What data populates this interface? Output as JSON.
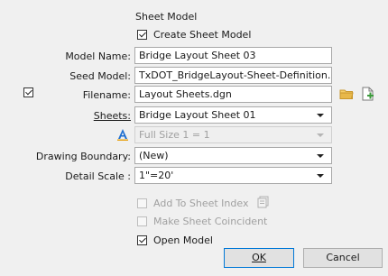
{
  "sheet_model": {
    "title": "Sheet Model",
    "create_sheet_model": {
      "label": "Create Sheet Model",
      "checked": true
    }
  },
  "fields": {
    "model_name": {
      "label": "Model Name:",
      "value": "Bridge Layout Sheet 03"
    },
    "seed_model": {
      "label": "Seed Model:",
      "value": "TxDOT_BridgeLayout-Sheet-Definition.dg"
    },
    "filename": {
      "label": "Filename:",
      "value": "Layout Sheets.dgn",
      "checked": true
    },
    "sheets": {
      "label": "Sheets:",
      "value": "Bridge Layout Sheet 01"
    },
    "annotation_scale": {
      "value": "Full Size 1 = 1"
    },
    "drawing_boundary": {
      "label": "Drawing Boundary:",
      "value": "(New)"
    },
    "detail_scale": {
      "label": "Detail Scale :",
      "value": "1\"=20'"
    }
  },
  "options": {
    "add_to_sheet_index": {
      "label": "Add To Sheet Index",
      "checked": false,
      "enabled": false
    },
    "make_sheet_coincident": {
      "label": "Make Sheet Coincident",
      "checked": false,
      "enabled": false
    },
    "open_model": {
      "label": "Open Model",
      "checked": true,
      "enabled": true
    }
  },
  "buttons": {
    "ok": "OK",
    "cancel": "Cancel"
  },
  "icons": {
    "browse": "folder-open-icon",
    "new_file": "new-file-icon",
    "annotation_scale": "annotation-scale-icon",
    "sheet_index": "sheet-index-icon"
  },
  "colors": {
    "folder": "#e8b84a",
    "annotation_blue": "#1f6fd1",
    "ok_border": "#0078d7"
  }
}
